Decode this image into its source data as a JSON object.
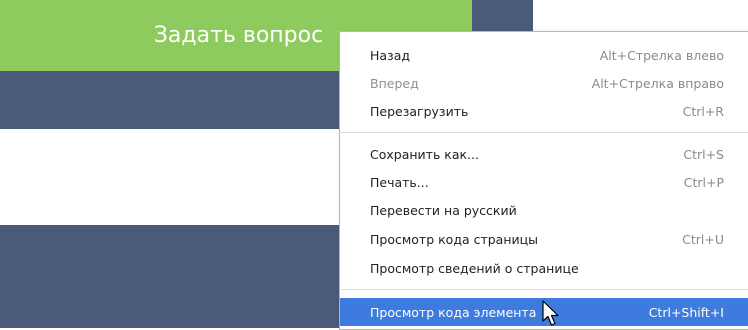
{
  "page": {
    "ask_button_label": "Задать вопрос"
  },
  "context_menu": {
    "items": [
      {
        "label": "Назад",
        "shortcut": "Alt+Стрелка влево",
        "disabled": false
      },
      {
        "label": "Вперед",
        "shortcut": "Alt+Стрелка вправо",
        "disabled": true
      },
      {
        "label": "Перезагрузить",
        "shortcut": "Ctrl+R",
        "disabled": false
      },
      {
        "label": "Сохранить как...",
        "shortcut": "Ctrl+S",
        "disabled": false
      },
      {
        "label": "Печать...",
        "shortcut": "Ctrl+P",
        "disabled": false
      },
      {
        "label": "Перевести на русский",
        "shortcut": "",
        "disabled": false
      },
      {
        "label": "Просмотр кода страницы",
        "shortcut": "Ctrl+U",
        "disabled": false
      },
      {
        "label": "Просмотр  сведений о странице",
        "shortcut": "",
        "disabled": false
      },
      {
        "label": "Просмотр кода элемента",
        "shortcut": "Ctrl+Shift+I",
        "highlighted": true
      }
    ]
  },
  "colors": {
    "band": "#4a5a7a",
    "ask_button": "#8ecb5e",
    "highlight": "#3e7bde"
  },
  "icons": {
    "cursor": "mouse-pointer-icon"
  }
}
